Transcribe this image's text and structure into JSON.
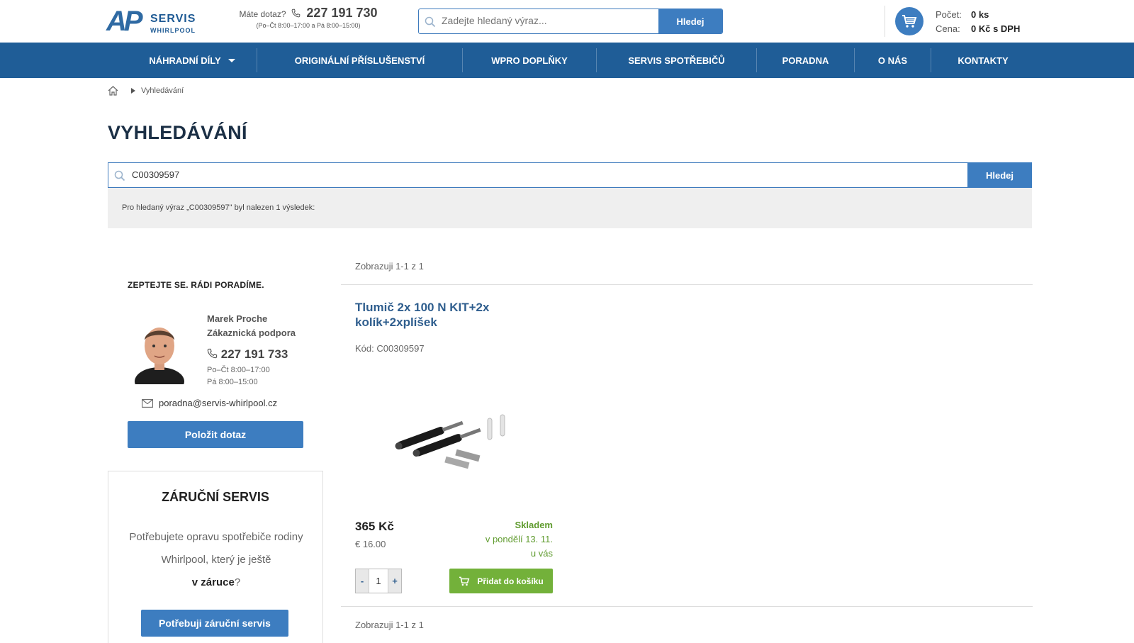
{
  "header": {
    "logo_ap": "AP",
    "logo_servis": "SERVIS",
    "logo_whirlpool": "WHIRLPOOL",
    "question": "Máte dotaz?",
    "phone": "227 191 730",
    "hours": "(Po–Čt 8:00–17:00 a Pá 8:00–15:00)",
    "search_placeholder": "Zadejte hledaný výraz...",
    "search_button": "Hledej",
    "cart": {
      "count_label": "Počet:",
      "count_value": "0 ks",
      "price_label": "Cena:",
      "price_value": "0 Kč s DPH"
    }
  },
  "nav": [
    {
      "label": "NÁHRADNÍ DÍLY"
    },
    {
      "label": "ORIGINÁLNÍ PŘÍSLUŠENSTVÍ"
    },
    {
      "label": "WPRO DOPLŇKY"
    },
    {
      "label": "SERVIS SPOTŘEBIČŮ"
    },
    {
      "label": "PORADNA"
    },
    {
      "label": "O NÁS"
    },
    {
      "label": "KONTAKTY"
    }
  ],
  "breadcrumb": {
    "current": "Vyhledávání"
  },
  "page_title": "VYHLEDÁVÁNÍ",
  "search": {
    "value": "C00309597",
    "button": "Hledej",
    "result_text": "Pro hledaný výraz „C00309597\" byl nalezen 1 výsledek:"
  },
  "sidebar": {
    "ask_title": "ZEPTEJTE SE. RÁDI PORADÍME.",
    "person_name": "Marek Proche",
    "person_role": "Zákaznická podpora",
    "phone": "227 191 733",
    "hours_1": "Po–Čt 8:00–17:00",
    "hours_2": "Pá 8:00–15:00",
    "email": "poradna@servis-whirlpool.cz",
    "ask_button": "Položit dotaz",
    "warranty_title": "ZÁRUČNÍ SERVIS",
    "warranty_text_1": "Potřebujete opravu spotřebiče rodiny Whirlpool, který je ještě",
    "warranty_text_bold": "v záruce",
    "warranty_text_end": "?",
    "warranty_button": "Potřebuji záruční servis"
  },
  "results": {
    "showing_top": "Zobrazuji 1-1 z 1",
    "showing_bottom": "Zobrazuji 1-1 z 1",
    "product": {
      "title": "Tlumič 2x 100 N KIT+2x kolík+2xplíšek",
      "code": "Kód: C00309597",
      "price": "365 Kč",
      "price_eur": "€ 16.00",
      "stock_status": "Skladem",
      "stock_line_2": "v pondělí 13. 11.",
      "stock_line_3": "u vás",
      "qty_minus": "-",
      "qty_value": "1",
      "qty_plus": "+",
      "add_button": "Přidat do košíku"
    }
  },
  "colors": {
    "brand_blue": "#1f5d97",
    "button_blue": "#3d7dc0",
    "green": "#73b13a",
    "stock_green": "#5f9b2e"
  }
}
